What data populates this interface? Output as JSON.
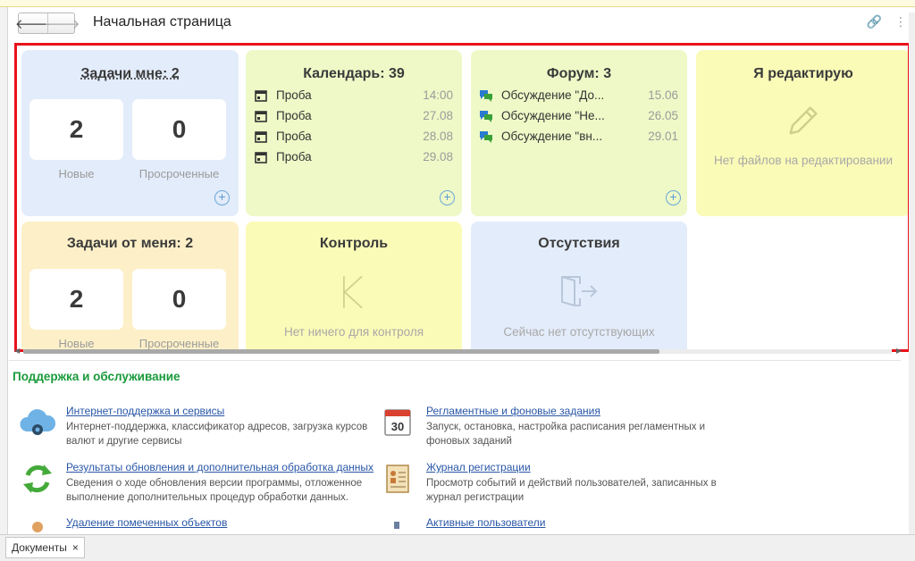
{
  "window": {
    "title": "Начальная страница",
    "back_icon": "arrow-left-icon",
    "forward_icon": "arrow-right-icon"
  },
  "tiles": {
    "tasks_me": {
      "title": "Задачи мне: 2",
      "new_count": "2",
      "new_label": "Новые",
      "overdue_count": "0",
      "overdue_label": "Просроченные",
      "bg": "#e3ecfa"
    },
    "calendar": {
      "title": "Календарь: 39",
      "bg": "#eef9c7",
      "items": [
        {
          "text": "Проба",
          "date": "14:00"
        },
        {
          "text": "Проба",
          "date": "27.08"
        },
        {
          "text": "Проба",
          "date": "28.08"
        },
        {
          "text": "Проба",
          "date": "29.08"
        }
      ]
    },
    "forum": {
      "title": "Форум: 3",
      "bg": "#eef9c7",
      "items": [
        {
          "text": "Обсуждение \"До...",
          "date": "15.06"
        },
        {
          "text": "Обсуждение \"Не...",
          "date": "26.05"
        },
        {
          "text": "Обсуждение \"вн...",
          "date": "29.01"
        }
      ]
    },
    "editing": {
      "title": "Я редактирую",
      "empty": "Нет файлов на редактировании",
      "bg": "#fbfbb8"
    },
    "tasks_from": {
      "title": "Задачи от меня: 2",
      "new_count": "2",
      "new_label": "Новые",
      "overdue_count": "0",
      "overdue_label": "Просроченные",
      "bg": "#fdf0c8"
    },
    "control": {
      "title": "Контроль",
      "empty": "Нет ничего для контроля",
      "bg": "#fbfbb8"
    },
    "absence": {
      "title": "Отсутствия",
      "empty": "Сейчас нет отсутствующих",
      "bg": "#e3ecfa"
    }
  },
  "support": {
    "heading": "Поддержка и обслуживание",
    "items": [
      {
        "link": "Интернет-поддержка и сервисы",
        "desc": "Интернет-поддержка, классификатор адресов, загрузка курсов валют и другие сервисы",
        "icon": "cloud-gear-icon"
      },
      {
        "link": "Регламентные и фоновые задания",
        "desc": "Запуск, остановка, настройка расписания регламентных и фоновых заданий",
        "icon": "calendar-30-icon",
        "icon_text": "30"
      },
      {
        "link": "Результаты обновления и дополнительная обработка данных",
        "desc": "Сведения о ходе обновления версии программы, отложенное выполнение дополнительных процедур обработки данных.",
        "icon": "refresh-icon"
      },
      {
        "link": "Журнал регистрации",
        "desc": "Просмотр событий и действий пользователей, записанных в журнал регистрации",
        "icon": "journal-icon"
      },
      {
        "link": "Удаление помеченных объектов",
        "desc": "",
        "icon": "delete-marked-icon"
      },
      {
        "link": "Активные пользователи",
        "desc": "",
        "icon": "users-icon"
      }
    ]
  },
  "bottom": {
    "tab_label": "Документы",
    "close": "×"
  },
  "colors": {
    "accent_red": "#e8131a",
    "link": "#2856a6",
    "support_heading": "#1a9a3b"
  }
}
